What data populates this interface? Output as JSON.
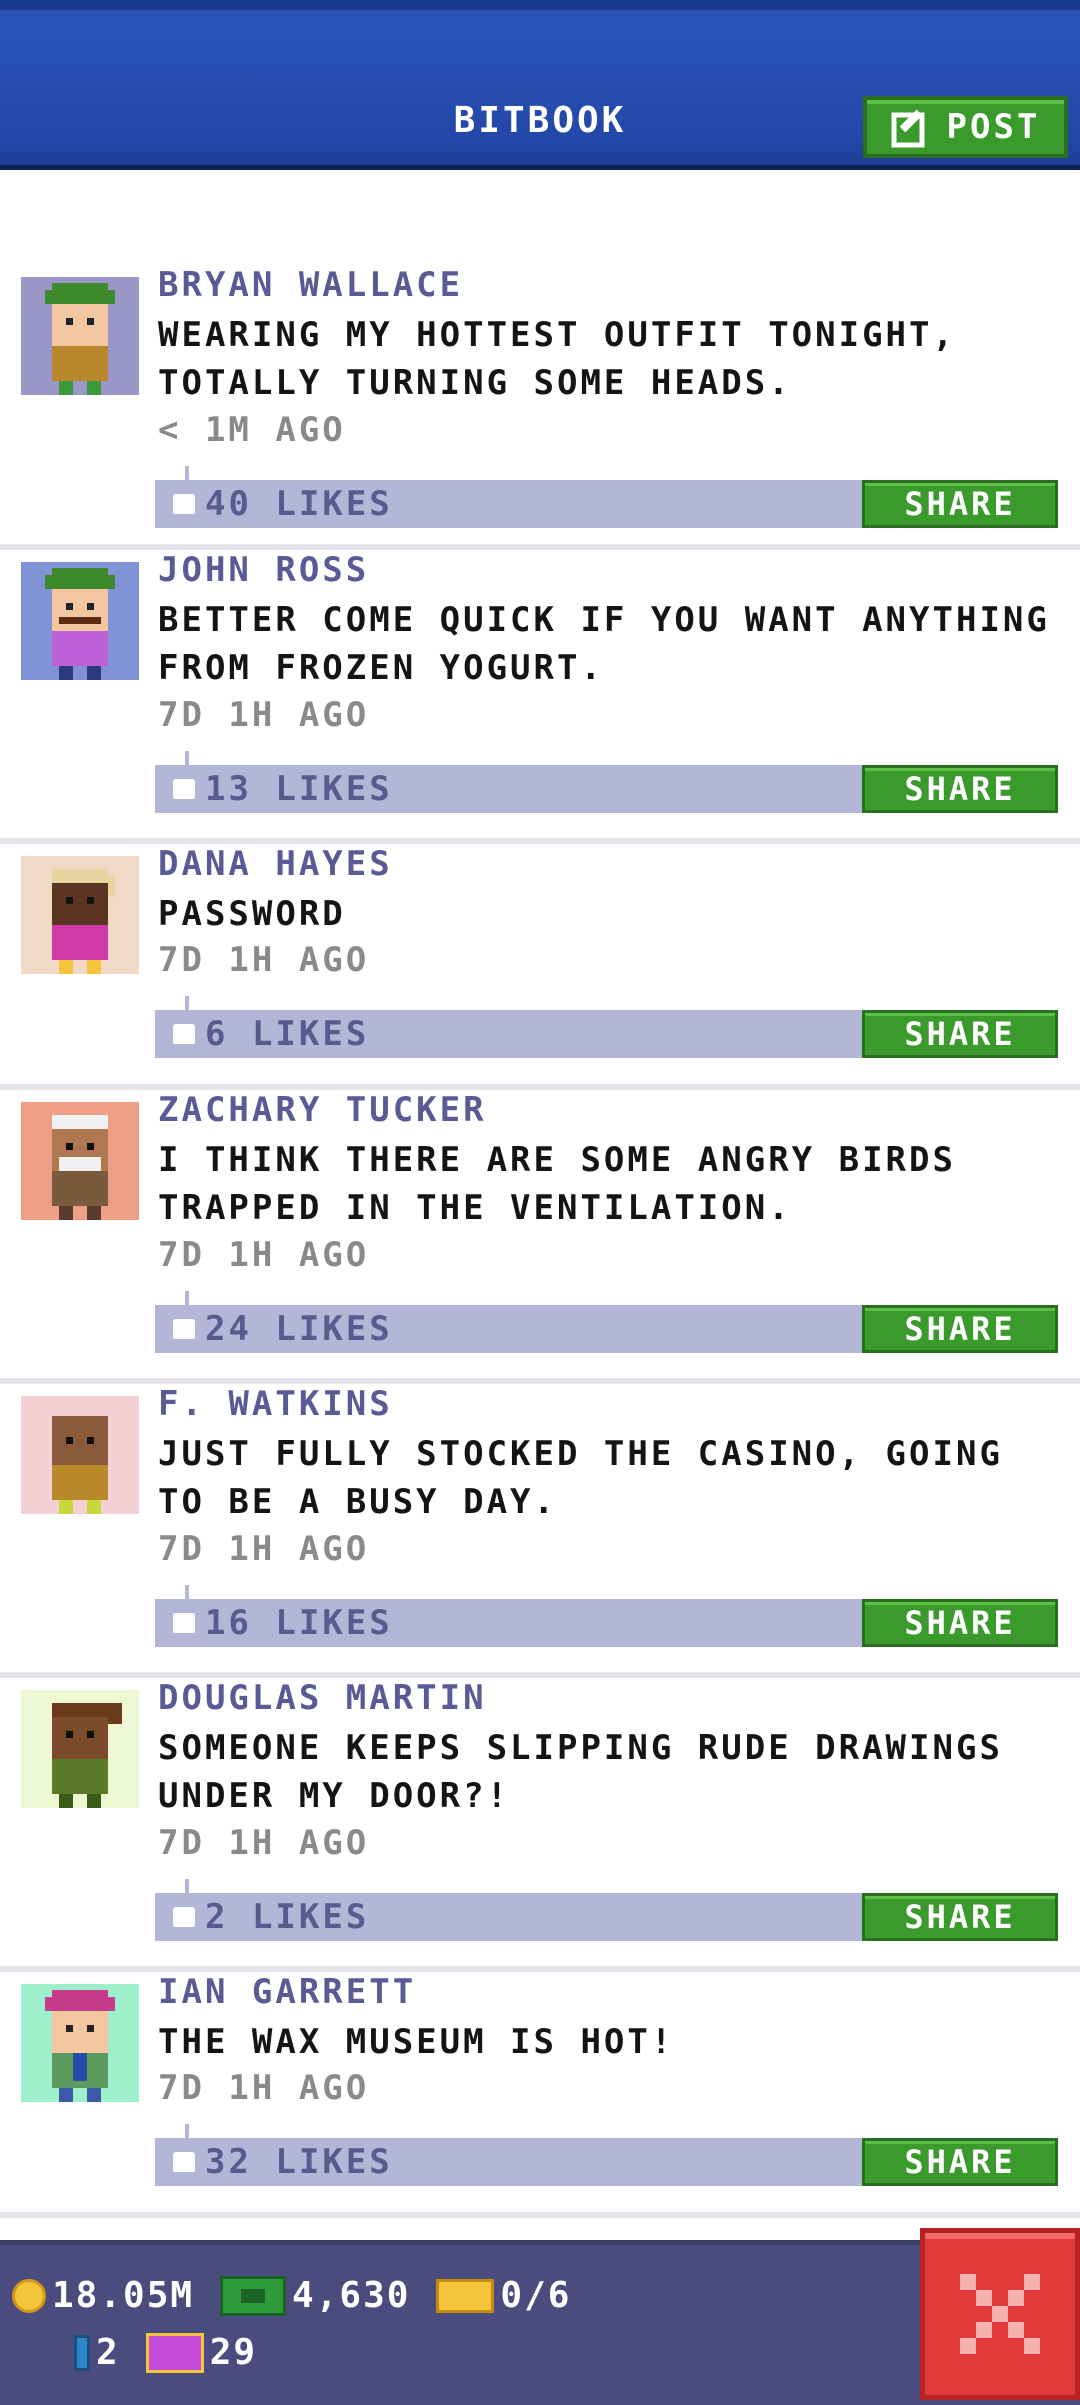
{
  "header": {
    "title": "BITBOOK",
    "post_label": "POST"
  },
  "posts": [
    {
      "name": "BRYAN WALLACE",
      "message": "WEARING MY HOTTEST OUTFIT TONIGHT, TOTALLY TURNING SOME HEADS.",
      "time": "< 1M AGO",
      "likes": "40 LIKES",
      "share": "SHARE",
      "avatar_bg": "#9a96c8"
    },
    {
      "name": "JOHN ROSS",
      "message": "BETTER COME QUICK IF YOU WANT ANYTHING FROM FROZEN YOGURT.",
      "time": "7D 1H AGO",
      "likes": "13 LIKES",
      "share": "SHARE",
      "avatar_bg": "#7f93d6"
    },
    {
      "name": "DANA HAYES",
      "message": "PASSWORD",
      "time": "7D 1H AGO",
      "likes": "6 LIKES",
      "share": "SHARE",
      "avatar_bg": "#f1d9c7"
    },
    {
      "name": "ZACHARY TUCKER",
      "message": "I THINK THERE ARE SOME ANGRY BIRDS TRAPPED IN THE VENTILATION.",
      "time": "7D 1H AGO",
      "likes": "24 LIKES",
      "share": "SHARE",
      "avatar_bg": "#ec9e86"
    },
    {
      "name": "F. WATKINS",
      "message": "JUST FULLY STOCKED THE CASINO, GOING TO BE A BUSY DAY.",
      "time": "7D 1H AGO",
      "likes": "16 LIKES",
      "share": "SHARE",
      "avatar_bg": "#f4cfd3"
    },
    {
      "name": "DOUGLAS MARTIN",
      "message": "SOMEONE KEEPS SLIPPING RUDE DRAWINGS UNDER MY DOOR?!",
      "time": "7D 1H AGO",
      "likes": "2 LIKES",
      "share": "SHARE",
      "avatar_bg": "#eef8d2"
    },
    {
      "name": "IAN GARRETT",
      "message": "THE WAX MUSEUM IS HOT!",
      "time": "7D 1H AGO",
      "likes": "32 LIKES",
      "share": "SHARE",
      "avatar_bg": "#9ef0cc"
    }
  ],
  "footer": {
    "coins": "18.05M",
    "bux": "4,630",
    "tickets": "0/6",
    "bitizens": "2",
    "vip": "29"
  }
}
